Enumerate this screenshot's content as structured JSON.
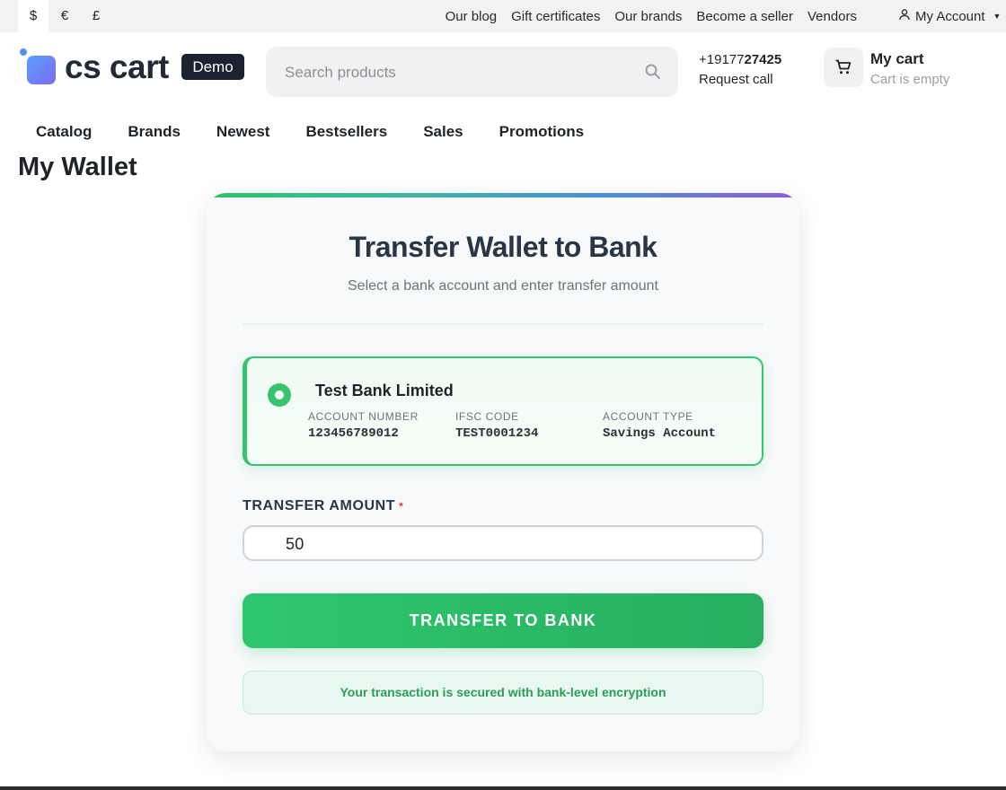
{
  "topbar": {
    "currencies": [
      "$",
      "€",
      "£"
    ],
    "active_currency": "$",
    "links": [
      "Our blog",
      "Gift certificates",
      "Our brands",
      "Become a seller",
      "Vendors"
    ],
    "account_label": "My Account"
  },
  "header": {
    "logo_text": "cs cart",
    "logo_badge": "Demo",
    "search_placeholder": "Search products",
    "phone_prefix": "+19177",
    "phone_bold": "27425",
    "request_call": "Request call",
    "cart_title": "My cart",
    "cart_subtitle": "Cart is empty"
  },
  "nav": [
    "Catalog",
    "Brands",
    "Newest",
    "Bestsellers",
    "Sales",
    "Promotions"
  ],
  "page_title": "My Wallet",
  "card": {
    "title": "Transfer Wallet to Bank",
    "subtitle": "Select a bank account and enter transfer amount",
    "bank": {
      "name": "Test Bank Limited",
      "fields": [
        {
          "label": "ACCOUNT NUMBER",
          "value": "123456789012"
        },
        {
          "label": "IFSC CODE",
          "value": "TEST0001234"
        },
        {
          "label": "ACCOUNT TYPE",
          "value": "Savings Account"
        }
      ]
    },
    "amount_label": "TRANSFER AMOUNT",
    "amount_required_mark": "*",
    "amount_value": "50",
    "transfer_button": "TRANSFER TO BANK",
    "secure_note": "Your transaction is secured with bank-level encryption"
  },
  "colors": {
    "accent_green": "#2ec76d",
    "brand_dark": "#1c2230",
    "required_red": "#e53935"
  },
  "icons": [
    "user-icon",
    "search-icon",
    "cart-icon",
    "radio-selected-icon"
  ]
}
